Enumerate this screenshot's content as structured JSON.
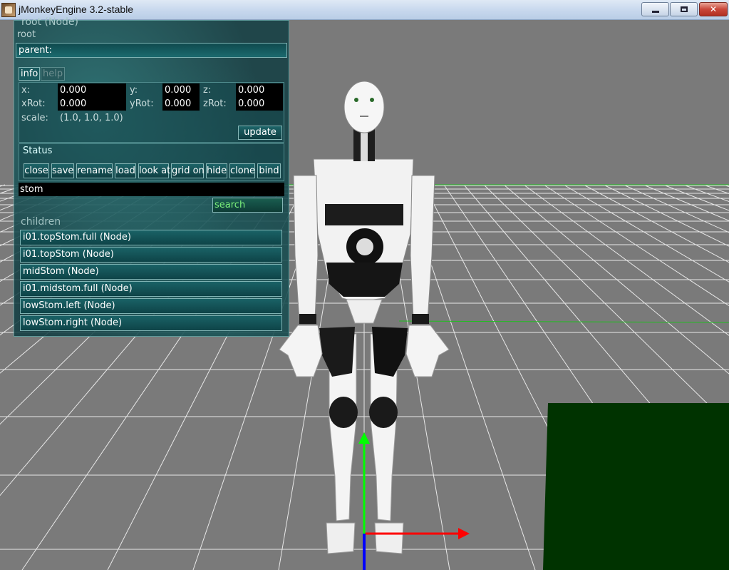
{
  "window": {
    "title": "jMonkeyEngine 3.2-stable",
    "controls": {
      "minimize": "minimize-icon",
      "maximize": "maximize-icon",
      "close": "✕"
    }
  },
  "inspector": {
    "node_title": "root (Node)",
    "node_name": "root",
    "parent": "parent:",
    "tabs": {
      "info": "info",
      "help": "help"
    },
    "transform": {
      "x_label": "x:",
      "x": "0.000",
      "y_label": "y:",
      "y": "0.000",
      "z_label": "z:",
      "z": "0.000",
      "xrot_label": "xRot:",
      "xrot": "0.000",
      "yrot_label": "yRot:",
      "yrot": "0.000",
      "zrot_label": "zRot:",
      "zrot": "0.000",
      "scale_label": "scale:",
      "scale": "(1.0, 1.0, 1.0)",
      "update": "update"
    },
    "status": {
      "label": "Status",
      "buttons": [
        "close",
        "save",
        "rename",
        "load",
        "look at",
        "grid on",
        "hide",
        "clone",
        "bind"
      ]
    },
    "search": {
      "value": "stom",
      "button": "search"
    },
    "children": {
      "label": "children",
      "items": [
        "i01.topStom.full (Node)",
        "i01.topStom (Node)",
        "midStom (Node)",
        "i01.midstom.full (Node)",
        "lowStom.left (Node)",
        "lowStom.right (Node)"
      ]
    }
  },
  "scene": {
    "background": "#7a7a7a",
    "grid_color": "#e6e6e6",
    "axis_colors": {
      "x": "#ff0000",
      "y": "#00ff00",
      "z": "#0000ff"
    },
    "green_plane": "#003300",
    "model": "robot-model"
  }
}
